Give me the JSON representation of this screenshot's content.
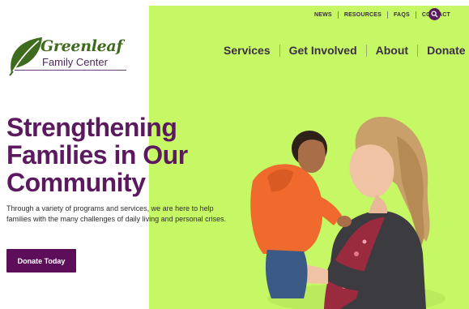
{
  "brand": {
    "name": "Greenleaf",
    "subtitle": "Family Center",
    "leaf_color": "#3f6b1e",
    "accent": "#5c1a5e",
    "panel_color": "#c6f765"
  },
  "utility_nav": {
    "items": [
      "NEWS",
      "RESOURCES",
      "FAQS",
      "CONTACT"
    ],
    "search_icon": "search-icon"
  },
  "main_nav": {
    "items": [
      "Services",
      "Get Involved",
      "About",
      "Donate"
    ]
  },
  "hero": {
    "title_lines": [
      "Strengthening",
      "Families in Our",
      "Community"
    ],
    "description": "Through a variety of programs and services, we are here to help families with the many challenges of daily living and personal crises.",
    "cta_label": "Donate Today"
  }
}
